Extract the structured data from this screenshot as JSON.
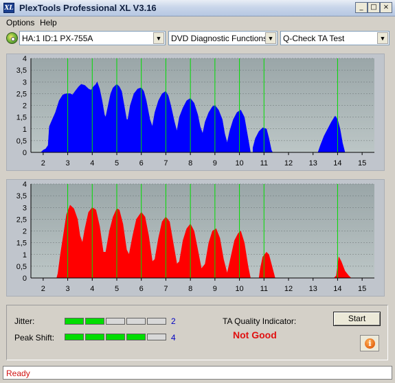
{
  "window": {
    "title": "PlexTools Professional XL V3.16",
    "icon_text": "XL"
  },
  "title_buttons": {
    "minimize": "_",
    "maximize": "□",
    "close": "×"
  },
  "menu": [
    {
      "label": "Options"
    },
    {
      "label": "Help"
    }
  ],
  "toolbar": {
    "drive": "HA:1 ID:1  PX-755A",
    "function": "DVD Diagnostic Functions",
    "test": "Q-Check TA Test",
    "arrow": "▼"
  },
  "results": {
    "jitter_label": "Jitter:",
    "jitter_value": "2",
    "jitter_level": 2,
    "peak_shift_label": "Peak Shift:",
    "peak_shift_value": "4",
    "peak_shift_level": 4,
    "meter_segments": 5,
    "indicator_label": "TA Quality Indicator:",
    "indicator_value": "Not Good"
  },
  "buttons": {
    "start": "Start",
    "info": "i"
  },
  "status": {
    "text": "Ready"
  },
  "colors": {
    "top_chart": "#0000ff",
    "bottom_chart": "#ff0000",
    "reference_lines": "#00dd00",
    "meter_on": "#00dd00",
    "meter_off": "#d8d8d8",
    "plot_background": "#bcc6c6"
  },
  "chart_data": [
    {
      "type": "area",
      "color": "#0000ff",
      "xlim": [
        1.5,
        15.5
      ],
      "ylim": [
        0,
        4
      ],
      "yticks": [
        "0",
        "0,5",
        "1",
        "1,5",
        "2",
        "2,5",
        "3",
        "3,5",
        "4"
      ],
      "xticks": [
        "2",
        "3",
        "4",
        "5",
        "6",
        "7",
        "8",
        "9",
        "10",
        "11",
        "12",
        "13",
        "14",
        "15"
      ],
      "reference_lines": [
        3,
        4,
        5,
        6,
        7,
        8,
        9,
        10,
        11,
        14
      ],
      "series": [
        {
          "points": [
            [
              1.9,
              0
            ],
            [
              2.0,
              0.1
            ],
            [
              2.1,
              0.15
            ],
            [
              2.2,
              0.3
            ],
            [
              2.25,
              1.1
            ],
            [
              2.35,
              1.35
            ],
            [
              2.5,
              1.7
            ],
            [
              2.65,
              2.2
            ],
            [
              2.8,
              2.45
            ],
            [
              2.95,
              2.5
            ],
            [
              3.1,
              2.5
            ],
            [
              3.2,
              2.45
            ],
            [
              3.3,
              2.6
            ],
            [
              3.45,
              2.8
            ],
            [
              3.55,
              2.9
            ],
            [
              3.7,
              2.85
            ],
            [
              3.85,
              2.7
            ],
            [
              3.95,
              2.65
            ],
            [
              4.05,
              2.8
            ],
            [
              4.15,
              2.9
            ],
            [
              4.2,
              3.0
            ],
            [
              4.3,
              2.7
            ],
            [
              4.4,
              2.2
            ],
            [
              4.5,
              1.6
            ],
            [
              4.55,
              1.5
            ],
            [
              4.65,
              2.0
            ],
            [
              4.75,
              2.5
            ],
            [
              4.85,
              2.75
            ],
            [
              5.0,
              2.9
            ],
            [
              5.1,
              2.8
            ],
            [
              5.2,
              2.6
            ],
            [
              5.3,
              2.0
            ],
            [
              5.4,
              1.4
            ],
            [
              5.45,
              1.4
            ],
            [
              5.55,
              2.0
            ],
            [
              5.7,
              2.5
            ],
            [
              5.85,
              2.7
            ],
            [
              6.0,
              2.75
            ],
            [
              6.1,
              2.6
            ],
            [
              6.2,
              2.2
            ],
            [
              6.35,
              1.4
            ],
            [
              6.45,
              1.1
            ],
            [
              6.55,
              1.7
            ],
            [
              6.7,
              2.2
            ],
            [
              6.85,
              2.5
            ],
            [
              7.0,
              2.6
            ],
            [
              7.1,
              2.4
            ],
            [
              7.2,
              2.0
            ],
            [
              7.35,
              1.3
            ],
            [
              7.45,
              0.9
            ],
            [
              7.55,
              1.5
            ],
            [
              7.7,
              1.9
            ],
            [
              7.85,
              2.2
            ],
            [
              8.0,
              2.3
            ],
            [
              8.15,
              2.1
            ],
            [
              8.3,
              1.6
            ],
            [
              8.4,
              1.1
            ],
            [
              8.5,
              0.8
            ],
            [
              8.6,
              1.3
            ],
            [
              8.75,
              1.7
            ],
            [
              8.9,
              1.95
            ],
            [
              9.0,
              2.0
            ],
            [
              9.15,
              1.8
            ],
            [
              9.3,
              1.4
            ],
            [
              9.4,
              0.8
            ],
            [
              9.5,
              0.4
            ],
            [
              9.6,
              0.9
            ],
            [
              9.75,
              1.4
            ],
            [
              9.9,
              1.7
            ],
            [
              10.05,
              1.8
            ],
            [
              10.2,
              1.5
            ],
            [
              10.3,
              0.9
            ],
            [
              10.4,
              0.3
            ],
            [
              10.45,
              0
            ],
            [
              10.55,
              0.2
            ],
            [
              10.65,
              0.6
            ],
            [
              10.8,
              0.9
            ],
            [
              10.95,
              1.05
            ],
            [
              11.1,
              1.0
            ],
            [
              11.2,
              0.6
            ],
            [
              11.3,
              0.1
            ],
            [
              11.35,
              0
            ],
            [
              13.2,
              0
            ],
            [
              13.3,
              0.3
            ],
            [
              13.45,
              0.7
            ],
            [
              13.6,
              1.0
            ],
            [
              13.75,
              1.3
            ],
            [
              13.9,
              1.55
            ],
            [
              14.0,
              1.4
            ],
            [
              14.1,
              1.0
            ],
            [
              14.2,
              0.4
            ],
            [
              14.3,
              0
            ]
          ]
        }
      ]
    },
    {
      "type": "area",
      "color": "#ff0000",
      "xlim": [
        1.5,
        15.5
      ],
      "ylim": [
        0,
        4
      ],
      "yticks": [
        "0",
        "0,5",
        "1",
        "1,5",
        "2",
        "2,5",
        "3",
        "3,5",
        "4"
      ],
      "xticks": [
        "2",
        "3",
        "4",
        "5",
        "6",
        "7",
        "8",
        "9",
        "10",
        "11",
        "12",
        "13",
        "14",
        "15"
      ],
      "reference_lines": [
        3,
        4,
        5,
        6,
        7,
        8,
        9,
        10,
        11,
        14
      ],
      "series": [
        {
          "points": [
            [
              2.55,
              0
            ],
            [
              2.6,
              0.2
            ],
            [
              2.7,
              1.0
            ],
            [
              2.85,
              2.0
            ],
            [
              2.95,
              2.7
            ],
            [
              3.1,
              3.1
            ],
            [
              3.25,
              2.95
            ],
            [
              3.4,
              2.5
            ],
            [
              3.5,
              1.8
            ],
            [
              3.6,
              1.5
            ],
            [
              3.7,
              2.1
            ],
            [
              3.85,
              2.8
            ],
            [
              4.0,
              3.0
            ],
            [
              4.15,
              2.9
            ],
            [
              4.3,
              2.2
            ],
            [
              4.45,
              1.1
            ],
            [
              4.55,
              1.1
            ],
            [
              4.7,
              2.0
            ],
            [
              4.85,
              2.6
            ],
            [
              5.0,
              2.95
            ],
            [
              5.1,
              2.9
            ],
            [
              5.25,
              2.3
            ],
            [
              5.4,
              1.2
            ],
            [
              5.5,
              1.0
            ],
            [
              5.65,
              1.8
            ],
            [
              5.8,
              2.5
            ],
            [
              6.0,
              2.8
            ],
            [
              6.15,
              2.6
            ],
            [
              6.3,
              1.8
            ],
            [
              6.45,
              0.7
            ],
            [
              6.55,
              0.8
            ],
            [
              6.7,
              1.7
            ],
            [
              6.85,
              2.4
            ],
            [
              7.0,
              2.6
            ],
            [
              7.15,
              2.4
            ],
            [
              7.3,
              1.5
            ],
            [
              7.45,
              0.6
            ],
            [
              7.55,
              0.7
            ],
            [
              7.7,
              1.6
            ],
            [
              7.85,
              2.1
            ],
            [
              8.0,
              2.3
            ],
            [
              8.15,
              2.0
            ],
            [
              8.3,
              1.2
            ],
            [
              8.45,
              0.4
            ],
            [
              8.6,
              0.6
            ],
            [
              8.75,
              1.5
            ],
            [
              8.9,
              2.0
            ],
            [
              9.05,
              2.1
            ],
            [
              9.2,
              1.7
            ],
            [
              9.35,
              0.8
            ],
            [
              9.5,
              0.2
            ],
            [
              9.65,
              0.9
            ],
            [
              9.8,
              1.6
            ],
            [
              9.95,
              1.9
            ],
            [
              10.05,
              2.0
            ],
            [
              10.2,
              1.5
            ],
            [
              10.35,
              0.5
            ],
            [
              10.45,
              0
            ],
            [
              10.8,
              0
            ],
            [
              10.85,
              0.4
            ],
            [
              10.95,
              0.9
            ],
            [
              11.1,
              1.1
            ],
            [
              11.2,
              1.0
            ],
            [
              11.35,
              0.4
            ],
            [
              11.45,
              0
            ],
            [
              13.85,
              0
            ],
            [
              13.95,
              0.1
            ],
            [
              14.05,
              0.9
            ],
            [
              14.15,
              0.7
            ],
            [
              14.3,
              0.3
            ],
            [
              14.45,
              0.1
            ],
            [
              14.55,
              0
            ]
          ]
        }
      ]
    }
  ]
}
